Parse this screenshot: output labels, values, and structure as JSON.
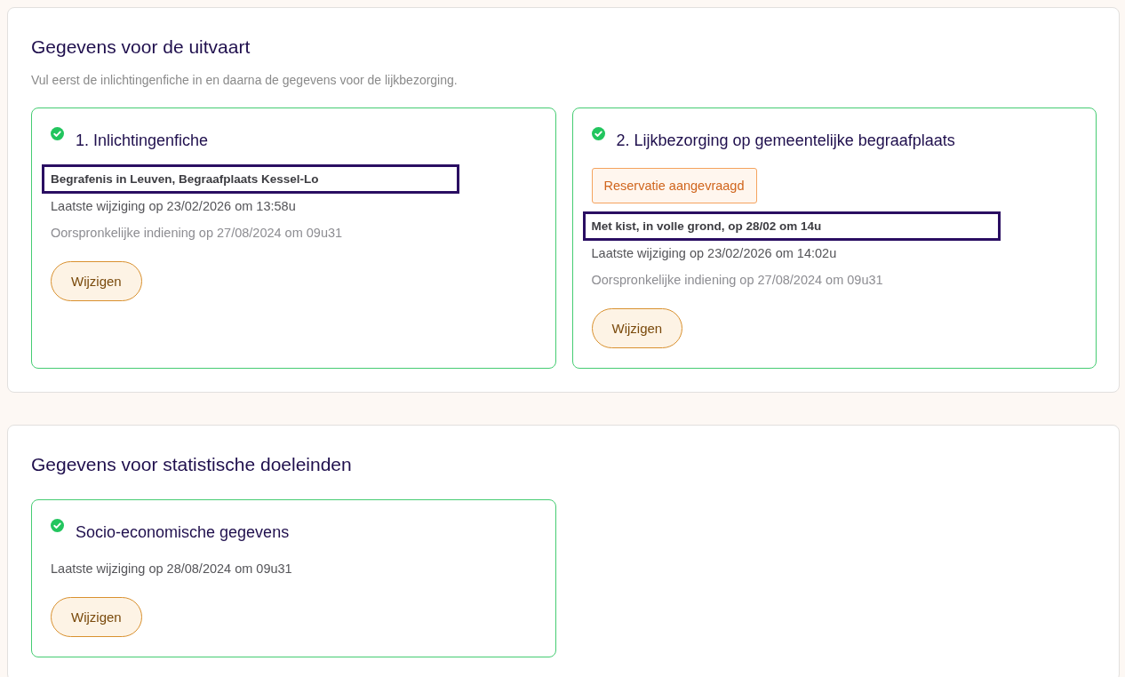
{
  "sections": [
    {
      "title": "Gegevens voor de uitvaart",
      "description": "Vul eerst de inlichtingenfiche in en daarna de gegevens voor de lijkbezorging.",
      "cards": [
        {
          "title": "1. Inlichtingenfiche",
          "completed": true,
          "summary": {
            "text": "Begrafenis in Leuven, Begraafplaats Kessel-Lo",
            "highlighted": true
          },
          "lines": [
            {
              "kind": "modified",
              "text": "Laatste wijziging op 23/02/2026 om 13:58u"
            },
            {
              "kind": "submitted",
              "text": "Oorspronkelijke indiening op 27/08/2024 om 09u31"
            }
          ],
          "button": "Wijzigen"
        },
        {
          "title": "2. Lijkbezorging op gemeentelijke begraafplaats",
          "completed": true,
          "badge": "Reservatie aangevraagd",
          "summary": {
            "text": "Met kist, in volle grond, op 28/02 om 14u",
            "highlighted": true
          },
          "lines": [
            {
              "kind": "modified",
              "text": "Laatste wijziging op 23/02/2026 om 14:02u"
            },
            {
              "kind": "submitted",
              "text": "Oorspronkelijke indiening op 27/08/2024 om 09u31"
            }
          ],
          "button": "Wijzigen"
        }
      ]
    },
    {
      "title": "Gegevens voor statistische doeleinden",
      "cards": [
        {
          "title": "Socio-economische gegevens",
          "completed": true,
          "lines": [
            {
              "kind": "modified",
              "text": "Laatste wijziging op 28/08/2024 om 09u31"
            }
          ],
          "button": "Wijzigen"
        }
      ]
    }
  ]
}
